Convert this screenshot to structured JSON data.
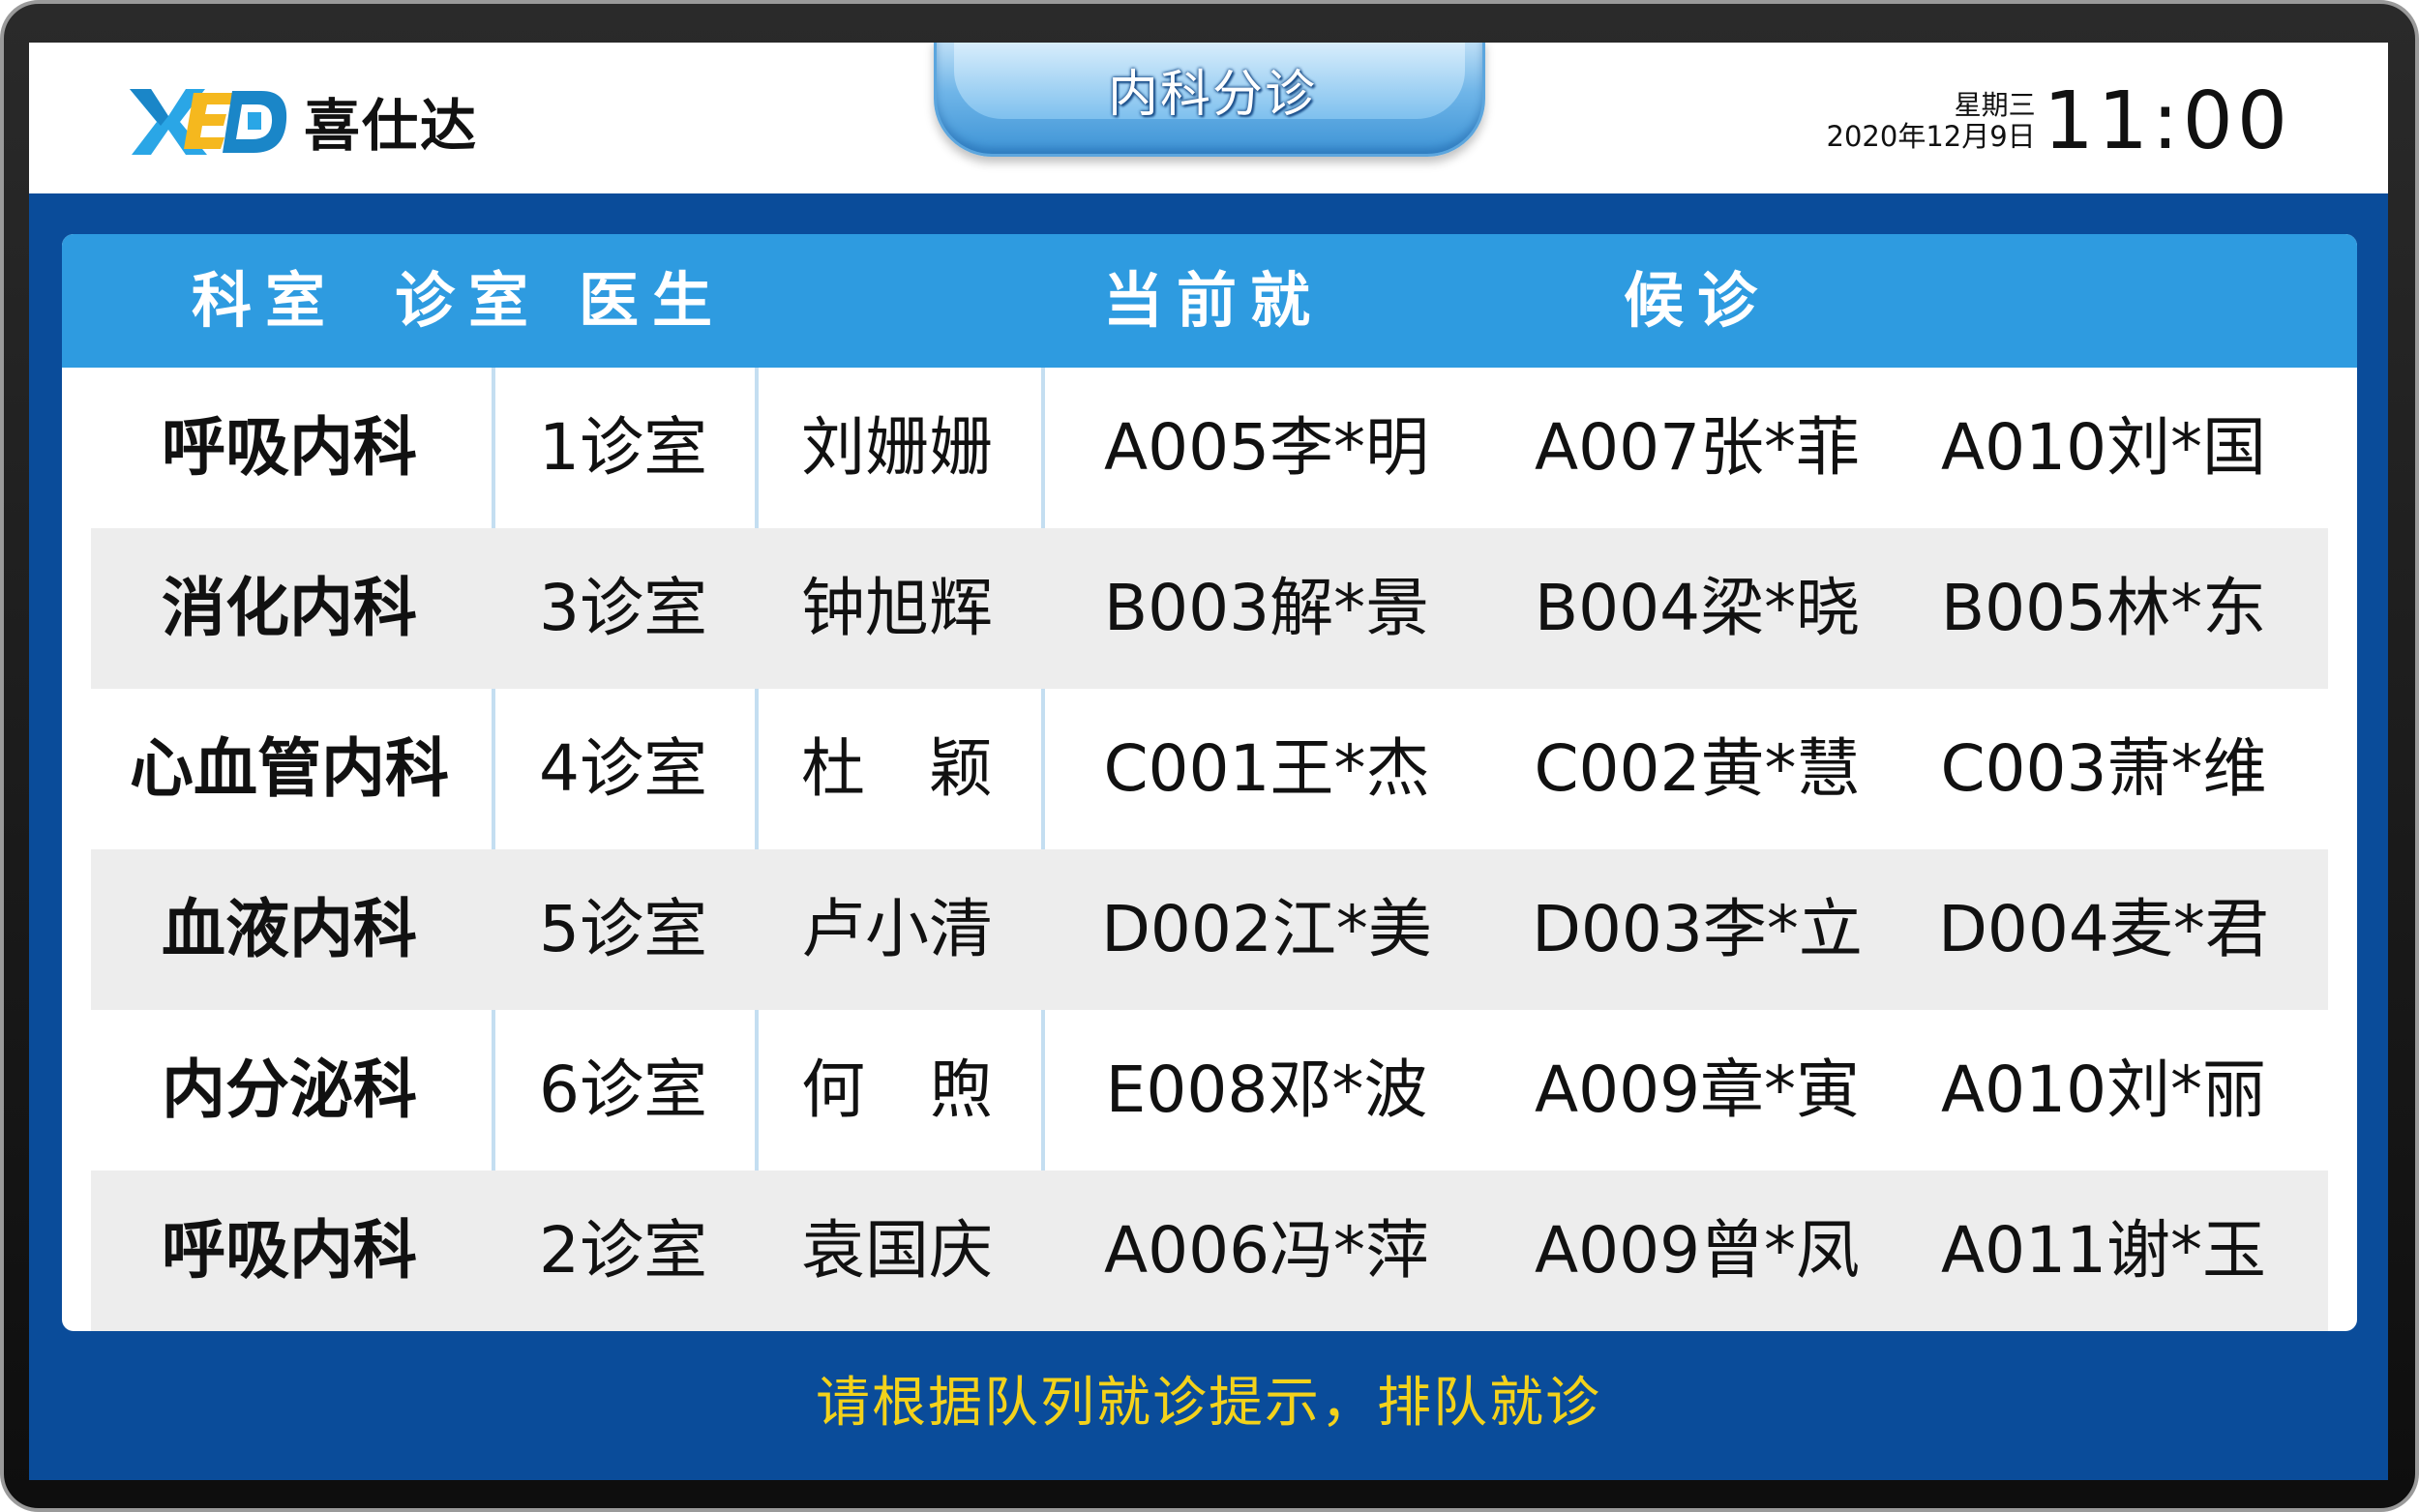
{
  "header": {
    "logo_text": "喜仕达",
    "title": "内科分诊",
    "weekday": "星期三",
    "date": "2020年12月9日",
    "time": "11:00"
  },
  "table": {
    "headers": [
      "科室",
      "诊室",
      "医生",
      "当前就诊",
      "候诊"
    ],
    "rows": [
      {
        "dept": "呼吸内科",
        "room": "1诊室",
        "doctor": "刘姗姗",
        "current": "A005李*明",
        "waiting1": "A007张*菲",
        "waiting2": "A010刘*国"
      },
      {
        "dept": "消化内科",
        "room": "3诊室",
        "doctor": "钟旭辉",
        "current": "B003解*景",
        "waiting1": "B004梁*晓",
        "waiting2": "B005林*东"
      },
      {
        "dept": "心血管内科",
        "room": "4诊室",
        "doctor": "杜　颖",
        "current": "C001王*杰",
        "waiting1": "C002黄*慧",
        "waiting2": "C003萧*维"
      },
      {
        "dept": "血液内科",
        "room": "5诊室",
        "doctor": "卢小清",
        "current": "D002江*美",
        "waiting1": "D003李*立",
        "waiting2": "D004麦*君"
      },
      {
        "dept": "内分泌科",
        "room": "6诊室",
        "doctor": "何　煦",
        "current": "E008邓*波",
        "waiting1": "A009章*寅",
        "waiting2": "A010刘*丽"
      },
      {
        "dept": "呼吸内科",
        "room": "2诊室",
        "doctor": "袁国庆",
        "current": "A006冯*萍",
        "waiting1": "A009曾*凤",
        "waiting2": "A011谢*玉"
      }
    ]
  },
  "footer": {
    "notice": "请根据队列就诊提示，排队就诊"
  },
  "colors": {
    "screen_bg": "#0a4c9a",
    "header_row": "#2e9be0",
    "notice": "#f3d21b",
    "alt_row": "#ededed"
  }
}
